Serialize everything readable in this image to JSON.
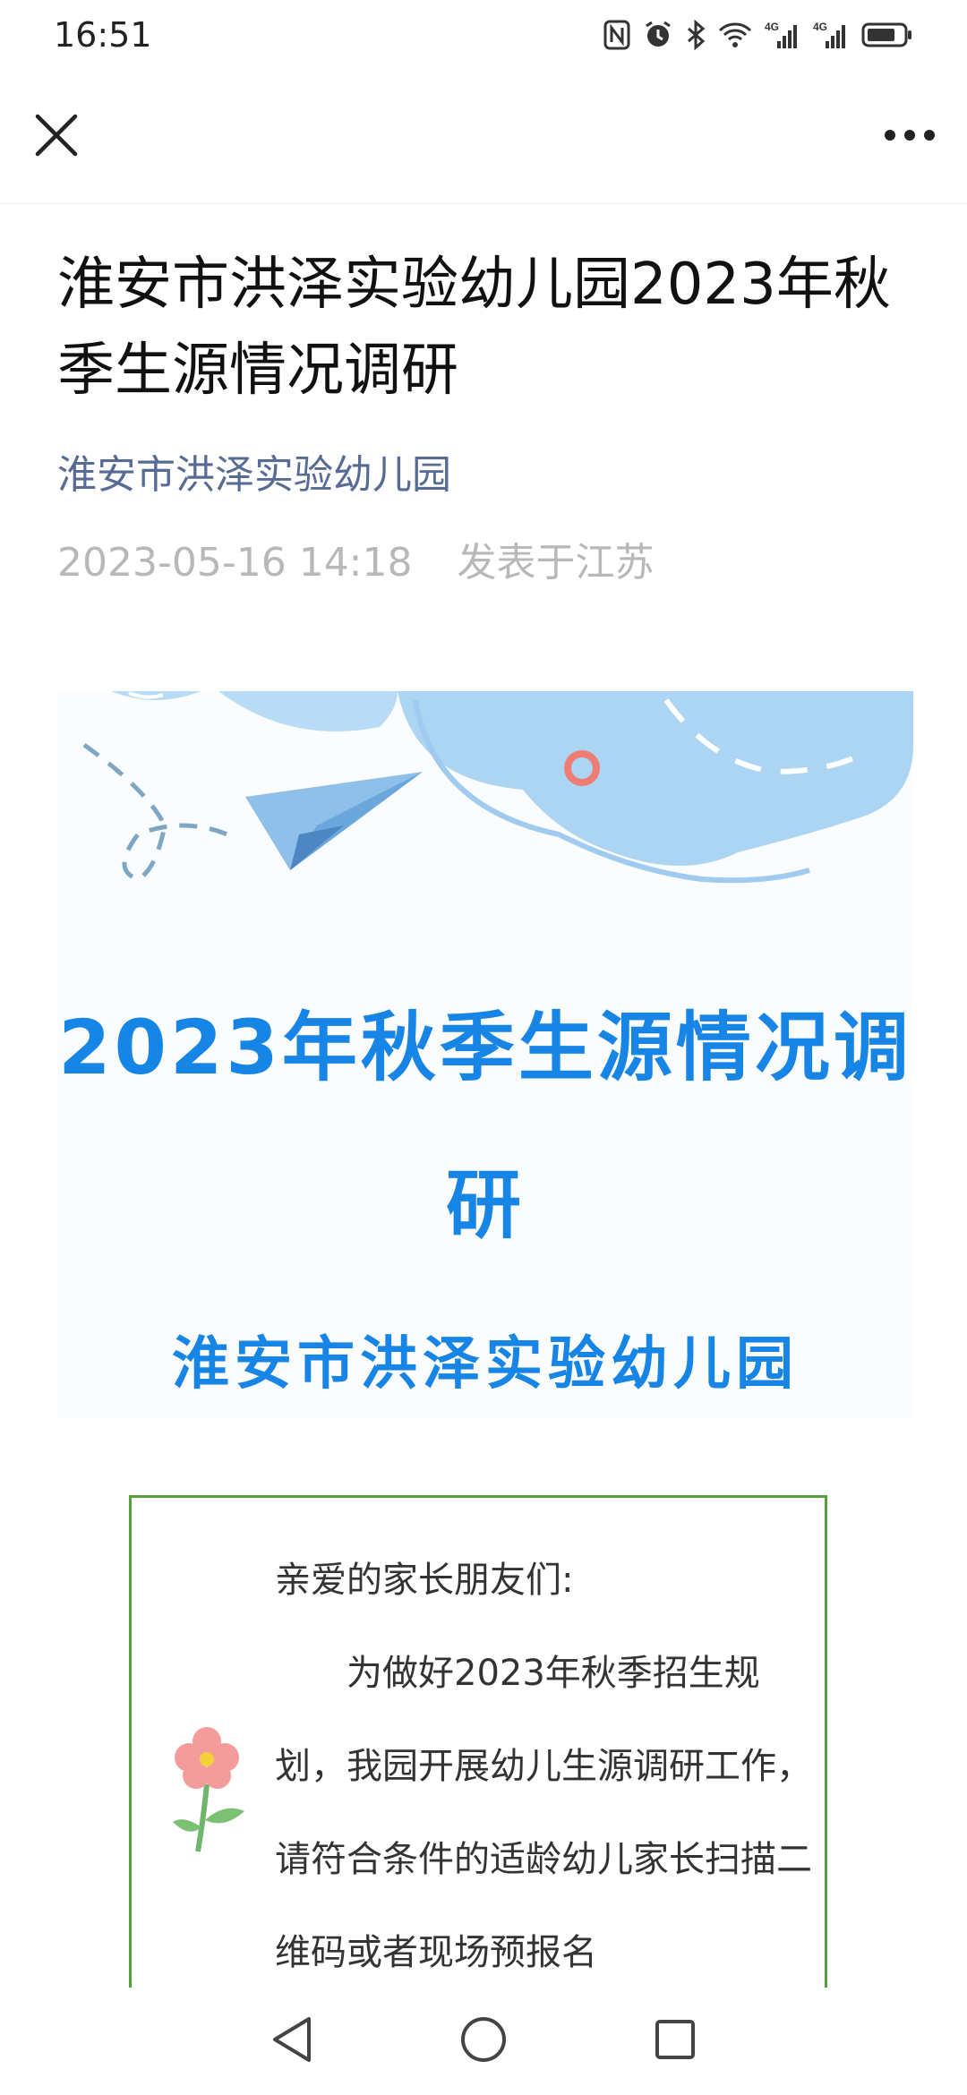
{
  "status_bar": {
    "time": "16:51",
    "icons": [
      "nfc-icon",
      "alarm-icon",
      "bluetooth-icon",
      "wifi-icon",
      "signal-4g-icon",
      "signal-4g-icon",
      "battery-icon"
    ],
    "network_label_1": "4G",
    "network_label_2": "4G"
  },
  "nav": {
    "close_icon": "close-icon",
    "more_icon": "more-icon"
  },
  "article": {
    "title": "淮安市洪泽实验幼儿园2023年秋季生源情况调研",
    "account_name": "淮安市洪泽实验幼儿园",
    "date": "2023-05-16 14:18",
    "location": "发表于江苏"
  },
  "banner": {
    "title": "2023年秋季生源情况调研",
    "subtitle": "淮安市洪泽实验幼儿园"
  },
  "notice": {
    "greeting": "亲爱的家长朋友们:",
    "body": "为做好2023年秋季招生规划，我园开展幼儿生源调研工作，请符合条件的适龄幼儿家长扫描二维码或者现场预报名"
  },
  "colors": {
    "accent_blue": "#1785e6",
    "account_link": "#576b95",
    "border_green": "#56a03a"
  },
  "system_nav": {
    "back_icon": "back-triangle-icon",
    "home_icon": "home-circle-icon",
    "recents_icon": "recents-square-icon"
  }
}
